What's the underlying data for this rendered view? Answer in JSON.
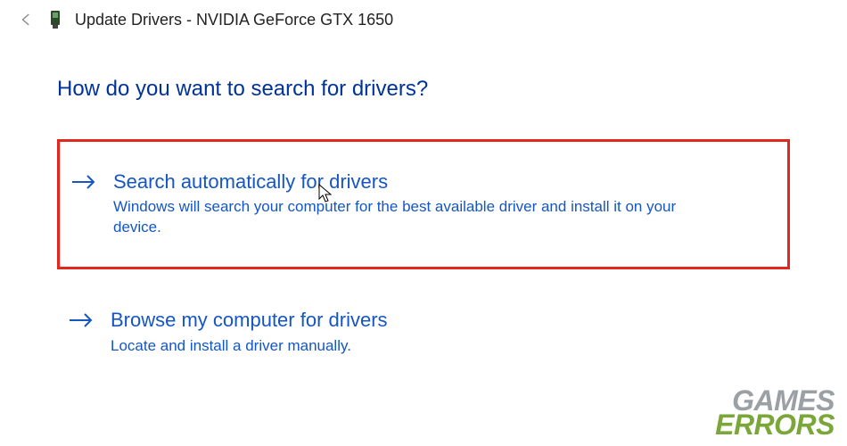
{
  "titlebar": {
    "window_title": "Update Drivers - NVIDIA GeForce GTX 1650"
  },
  "question": "How do you want to search for drivers?",
  "options": [
    {
      "title": "Search automatically for drivers",
      "description": "Windows will search your computer for the best available driver and install it on your device.",
      "highlighted": true
    },
    {
      "title": "Browse my computer for drivers",
      "description": "Locate and install a driver manually.",
      "highlighted": false
    }
  ],
  "watermark": {
    "line1": "GAMES",
    "line2": "ERRORS"
  }
}
